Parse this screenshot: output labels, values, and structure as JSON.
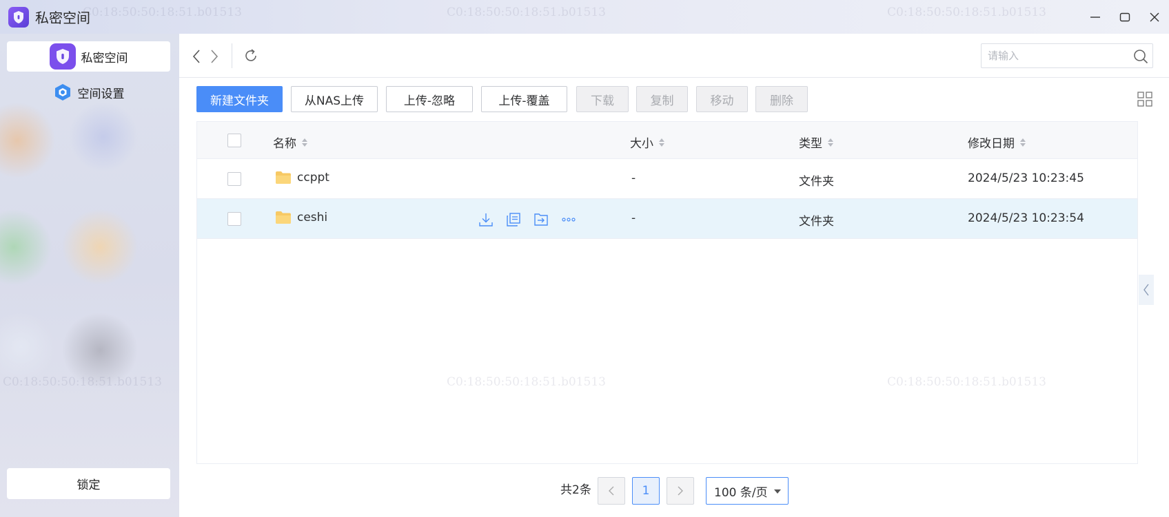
{
  "window": {
    "title": "私密空间",
    "watermark": "C0:18:50:50:18:51.b01513"
  },
  "sidebar": {
    "items": [
      {
        "label": "私密空间",
        "icon": "shield-icon",
        "active": true
      },
      {
        "label": "空间设置",
        "icon": "hexagon-settings-icon",
        "active": false
      }
    ],
    "lock_label": "锁定"
  },
  "navbar": {
    "search_placeholder": "请输入",
    "search_value": ""
  },
  "toolbar": {
    "buttons": [
      {
        "label": "新建文件夹",
        "style": "primary"
      },
      {
        "label": "从NAS上传",
        "style": "default"
      },
      {
        "label": "上传-忽略",
        "style": "default"
      },
      {
        "label": "上传-覆盖",
        "style": "default"
      },
      {
        "label": "下载",
        "style": "disabled"
      },
      {
        "label": "复制",
        "style": "disabled"
      },
      {
        "label": "移动",
        "style": "disabled"
      },
      {
        "label": "删除",
        "style": "disabled"
      }
    ]
  },
  "table": {
    "columns": [
      "名称",
      "大小",
      "类型",
      "修改日期"
    ],
    "rows": [
      {
        "name": "ccppt",
        "size": "-",
        "type": "文件夹",
        "modified": "2024/5/23 10:23:45",
        "hovered": false
      },
      {
        "name": "ceshi",
        "size": "-",
        "type": "文件夹",
        "modified": "2024/5/23 10:23:54",
        "hovered": true
      }
    ],
    "row_actions": [
      "download-icon",
      "copy-icon",
      "move-icon",
      "more-icon"
    ]
  },
  "pagination": {
    "total": "共2条",
    "current_page": "1",
    "page_size": "100 条/页"
  },
  "colors": {
    "accent": "#4a8df8",
    "hover_row": "#e8f4fb",
    "app_icon": "#7b4fec"
  }
}
